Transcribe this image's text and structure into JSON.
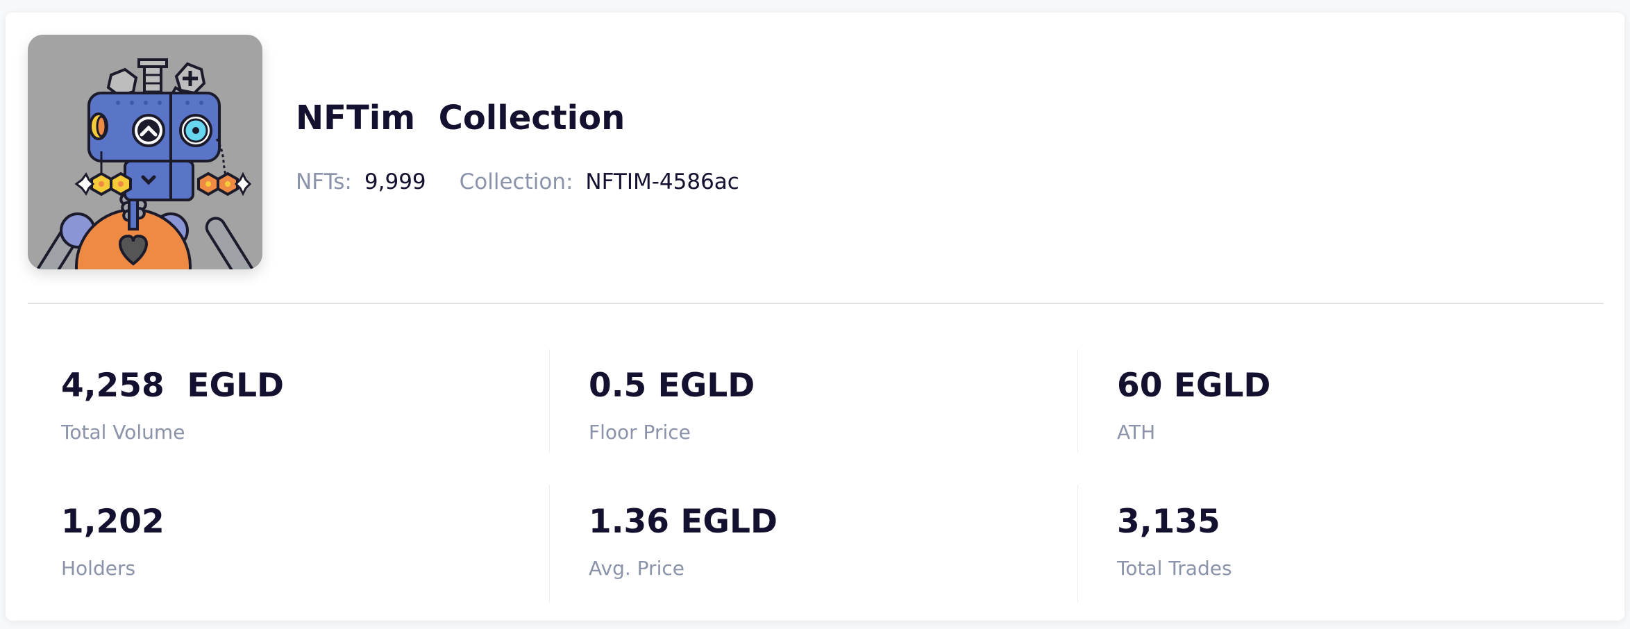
{
  "collection": {
    "title": "NFTim  Collection",
    "nfts_label": "NFTs:",
    "nfts_value": "9,999",
    "collection_label": "Collection:",
    "collection_value": "NFTIM-4586ac"
  },
  "stats": [
    {
      "value": "4,258  EGLD",
      "label": "Total Volume"
    },
    {
      "value": "0.5 EGLD",
      "label": "Floor Price"
    },
    {
      "value": "60 EGLD",
      "label": "ATH"
    },
    {
      "value": "1,202",
      "label": "Holders"
    },
    {
      "value": "1.36 EGLD",
      "label": "Avg. Price"
    },
    {
      "value": "3,135",
      "label": "Total Trades"
    }
  ],
  "colors": {
    "text_primary": "#13112f",
    "text_muted": "#8a93aa",
    "image_background": "#a3a3a3",
    "robot_head": "#5a74c8",
    "robot_body": "#ee8a44"
  },
  "icons": {
    "collection_image": "robot-nft-icon"
  }
}
